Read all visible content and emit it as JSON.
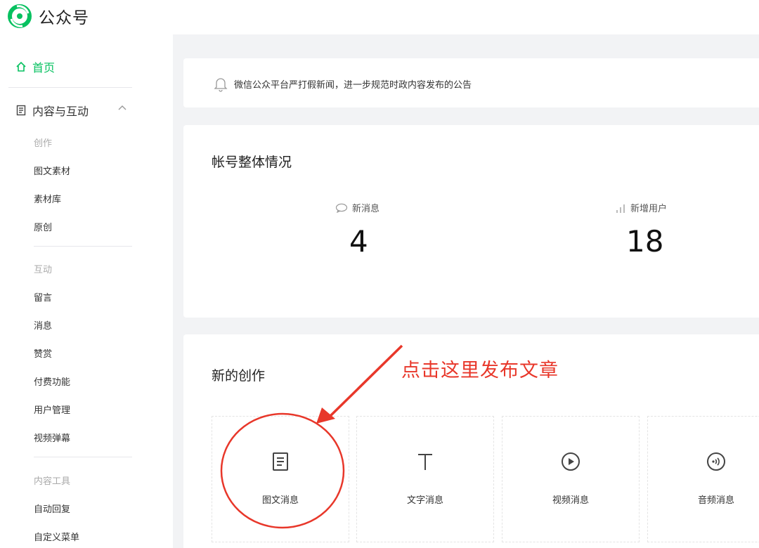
{
  "app": {
    "title": "公众号",
    "brand_color": "#07c160"
  },
  "sidebar": {
    "home": {
      "label": "首页",
      "icon": "home-icon"
    },
    "content_group": {
      "label": "内容与互动",
      "icon": "document-icon",
      "expanded": true
    },
    "sections": {
      "create": "创作",
      "interact": "互动",
      "tools": "内容工具"
    },
    "create_items": [
      "图文素材",
      "素材库",
      "原创"
    ],
    "interact_items": [
      "留言",
      "消息",
      "赞赏",
      "付费功能",
      "用户管理",
      "视频弹幕"
    ],
    "tool_items": [
      "自动回复",
      "自定义菜单"
    ]
  },
  "notice": {
    "icon": "bell-icon",
    "text": "微信公众平台严打假新闻，进一步规范时政内容发布的公告"
  },
  "overview": {
    "title": "帐号整体情况",
    "stats": [
      {
        "label": "新消息",
        "value": "4",
        "icon": "chat-bubble-icon"
      },
      {
        "label": "新增用户",
        "value": "18",
        "icon": "bar-chart-icon"
      }
    ]
  },
  "creation": {
    "title": "新的创作",
    "types": [
      {
        "label": "图文消息",
        "icon": "article-icon"
      },
      {
        "label": "文字消息",
        "icon": "text-icon"
      },
      {
        "label": "视频消息",
        "icon": "video-icon"
      },
      {
        "label": "音频消息",
        "icon": "audio-icon"
      }
    ]
  },
  "annotation": {
    "text": "点击这里发布文章",
    "color": "#e8372a"
  }
}
